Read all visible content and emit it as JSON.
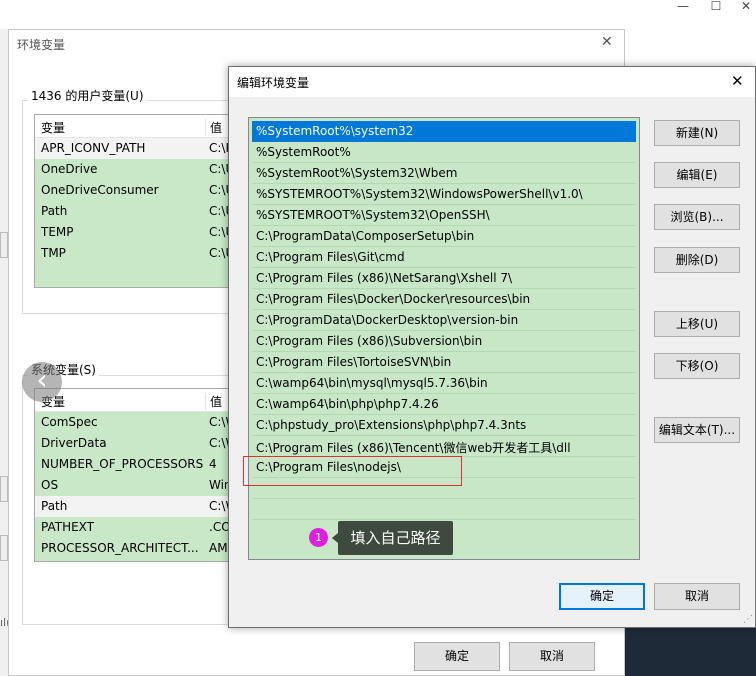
{
  "outer_window": {
    "controls": {
      "minimize": "—",
      "maximize": "☐",
      "close": "✕"
    }
  },
  "env_dialog": {
    "title": "环境变量",
    "close_glyph": "✕",
    "user_vars": {
      "label": "1436 的用户变量(U)",
      "col_name": "变量",
      "col_value": "值",
      "rows": [
        {
          "name": "APR_ICONV_PATH",
          "value": "C:\\P"
        },
        {
          "name": "OneDrive",
          "value": "C:\\U"
        },
        {
          "name": "OneDriveConsumer",
          "value": "C:\\U"
        },
        {
          "name": "Path",
          "value": "C:\\U"
        },
        {
          "name": "TEMP",
          "value": "C:\\U"
        },
        {
          "name": "TMP",
          "value": "C:\\U"
        }
      ]
    },
    "system_vars": {
      "label": "系统变量(S)",
      "col_name": "变量",
      "col_value": "值",
      "rows": [
        {
          "name": "ComSpec",
          "value": "C:\\W"
        },
        {
          "name": "DriverData",
          "value": "C:\\W"
        },
        {
          "name": "NUMBER_OF_PROCESSORS",
          "value": "4"
        },
        {
          "name": "OS",
          "value": "Win"
        },
        {
          "name": "Path",
          "value": "C:\\W"
        },
        {
          "name": "PATHEXT",
          "value": ".CO"
        },
        {
          "name": "PROCESSOR_ARCHITECT...",
          "value": "AM"
        }
      ]
    },
    "ok_label": "确定",
    "cancel_label": "取消",
    "left_edge_text": "ıl(",
    "nav_prev": "‹",
    "nav_next": "›"
  },
  "edit_dialog": {
    "title": "编辑环境变量",
    "close_glyph": "✕",
    "paths": [
      "%SystemRoot%\\system32",
      "%SystemRoot%",
      "%SystemRoot%\\System32\\Wbem",
      "%SYSTEMROOT%\\System32\\WindowsPowerShell\\v1.0\\",
      "%SYSTEMROOT%\\System32\\OpenSSH\\",
      "C:\\ProgramData\\ComposerSetup\\bin",
      "C:\\Program Files\\Git\\cmd",
      "C:\\Program Files (x86)\\NetSarang\\Xshell 7\\",
      "C:\\Program Files\\Docker\\Docker\\resources\\bin",
      "C:\\ProgramData\\DockerDesktop\\version-bin",
      "C:\\Program Files (x86)\\Subversion\\bin",
      "C:\\Program Files\\TortoiseSVN\\bin",
      "C:\\wamp64\\bin\\mysql\\mysql5.7.36\\bin",
      "C:\\wamp64\\bin\\php\\php7.4.26",
      "C:\\phpstudy_pro\\Extensions\\php\\php7.4.3nts",
      "C:\\Program Files (x86)\\Tencent\\微信web开发者工具\\dll",
      "C:\\Program Files\\nodejs\\",
      "",
      "",
      ""
    ],
    "buttons": {
      "new": "新建(N)",
      "edit": "编辑(E)",
      "browse": "浏览(B)...",
      "delete": "删除(D)",
      "move_up": "上移(U)",
      "move_down": "下移(O)",
      "edit_text": "编辑文本(T)..."
    },
    "ok_label": "确定",
    "cancel_label": "取消"
  },
  "annotation": {
    "badge": "1",
    "tooltip": "填入自己路径"
  },
  "colors": {
    "list_green": "#c7e7c7",
    "selection": "#0078d7",
    "highlight_box": "#e03030",
    "badge": "#e020e0",
    "tooltip_bg": "#3d4a3d"
  }
}
